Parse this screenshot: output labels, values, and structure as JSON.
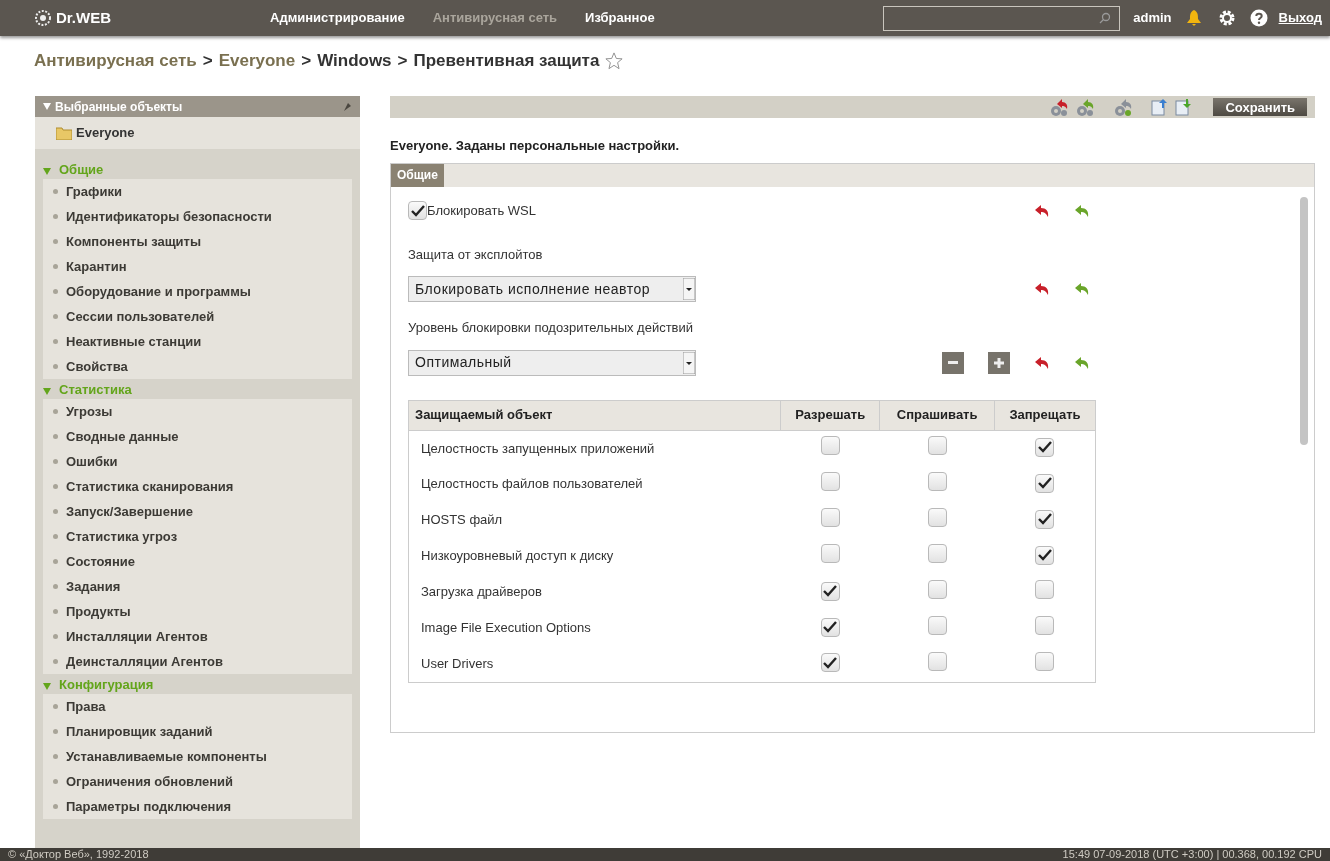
{
  "topbar": {
    "logo": "Dr.WEB",
    "nav": [
      {
        "label": "Администрирование",
        "selected": false
      },
      {
        "label": "Антивирусная сеть",
        "selected": true
      },
      {
        "label": "Избранное",
        "selected": false
      }
    ],
    "user": "admin",
    "logout": "Выход"
  },
  "breadcrumb": [
    {
      "label": "Антивирусная сеть",
      "link": true
    },
    {
      "label": ">",
      "link": false
    },
    {
      "label": "Everyone",
      "link": true
    },
    {
      "label": ">",
      "link": false
    },
    {
      "label": "Windows",
      "link": false
    },
    {
      "label": ">",
      "link": false
    },
    {
      "label": "Превентивная защита",
      "link": false
    }
  ],
  "sidebar": {
    "title": "Выбранные объекты",
    "object": "Everyone",
    "sections": [
      {
        "title": "Общие",
        "expanded": true,
        "items": [
          "Графики",
          "Идентификаторы безопасности",
          "Компоненты защиты",
          "Карантин",
          "Оборудование и программы",
          "Сессии пользователей",
          "Неактивные станции",
          "Свойства"
        ]
      },
      {
        "title": "Статистика",
        "expanded": true,
        "items": [
          "Угрозы",
          "Сводные данные",
          "Ошибки",
          "Статистика сканирования",
          "Запуск/Завершение",
          "Статистика угроз",
          "Состояние",
          "Задания",
          "Продукты",
          "Инсталляции Агентов",
          "Деинсталляции Агентов"
        ]
      },
      {
        "title": "Конфигурация",
        "expanded": true,
        "items": [
          "Права",
          "Планировщик заданий",
          "Устанавливаемые компоненты",
          "Ограничения обновлений",
          "Параметры подключения"
        ]
      }
    ]
  },
  "toolbar": {
    "save": "Сохранить"
  },
  "status": "Everyone. Заданы персональные настройки.",
  "tabs": [
    {
      "label": "Общие",
      "selected": true
    }
  ],
  "settings": [
    {
      "kind": "checkbox",
      "label": "Блокировать WSL",
      "checked": true
    },
    {
      "kind": "select",
      "label": "Защита от эксплойтов",
      "value": "Блокировать исполнение неавтор",
      "stepper": false
    },
    {
      "kind": "select",
      "label": "Уровень блокировки подозрительных действий",
      "value": "Оптимальный",
      "stepper": true
    }
  ],
  "table": {
    "columns": [
      "Защищаемый объект",
      "Разрешать",
      "Спрашивать",
      "Запрещать"
    ],
    "rows": [
      {
        "name": "Целостность запущенных приложений",
        "allow": false,
        "ask": false,
        "deny": true
      },
      {
        "name": "Целостность файлов пользователей",
        "allow": false,
        "ask": false,
        "deny": true
      },
      {
        "name": "HOSTS файл",
        "allow": false,
        "ask": false,
        "deny": true
      },
      {
        "name": "Низкоуровневый доступ к диску",
        "allow": false,
        "ask": false,
        "deny": true
      },
      {
        "name": "Загрузка драйверов",
        "allow": true,
        "ask": false,
        "deny": false
      },
      {
        "name": "Image File Execution Options",
        "allow": true,
        "ask": false,
        "deny": false
      },
      {
        "name": "User Drivers",
        "allow": true,
        "ask": false,
        "deny": false
      }
    ]
  },
  "footer": {
    "copyright": "© «Доктор Веб», 1992-2018",
    "info": "15:49 07-09-2018 (UTC +3:00) | 00.368, 00.192 CPU"
  }
}
